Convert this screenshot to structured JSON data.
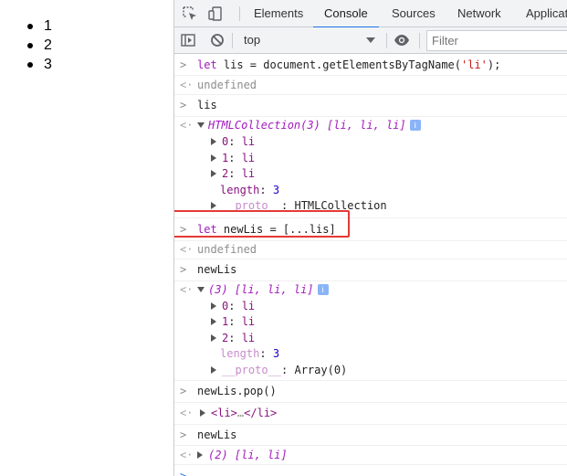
{
  "page": {
    "list_items": [
      "1",
      "2",
      "3"
    ]
  },
  "devtools": {
    "tabs": [
      "Elements",
      "Console",
      "Sources",
      "Network",
      "Applicat"
    ],
    "active_tab": "Console",
    "toolbar": {
      "context": "top",
      "filter_placeholder": "Filter"
    },
    "icons": [
      "inspect-icon",
      "device-toggle-icon",
      "sidebar-toggle-icon",
      "clear-console-icon",
      "eye-icon"
    ],
    "colors": {
      "active_tab_underline": "#1a73e8",
      "highlight_box": "#e53935"
    }
  },
  "console": {
    "m1_input": [
      "let",
      " lis = document.getElementsByTagName(",
      "'li'",
      ");"
    ],
    "m1_result": "undefined",
    "m2_input": "lis",
    "m2_summary": [
      "HTMLCollection(3) [",
      "li, li, li",
      "]"
    ],
    "m2_info": "i",
    "m2_children": [
      {
        "key": "0",
        "val": "li"
      },
      {
        "key": "1",
        "val": "li"
      },
      {
        "key": "2",
        "val": "li"
      }
    ],
    "m2_length_key": "length",
    "m2_length_val": "3",
    "m2_proto_key": "__proto__",
    "m2_proto_val": ": HTMLCollection",
    "m3_input": [
      "let",
      " newLis = [...lis]"
    ],
    "m3_result": "undefined",
    "m4_input": "newLis",
    "m4_summary": [
      "(3) [",
      "li, li, li",
      "]"
    ],
    "m4_info": "i",
    "m4_children": [
      {
        "key": "0",
        "val": "li"
      },
      {
        "key": "1",
        "val": "li"
      },
      {
        "key": "2",
        "val": "li"
      }
    ],
    "m4_length_key": "length",
    "m4_length_val": "3",
    "m4_proto_key": "__proto__",
    "m4_proto_val": ": Array(0)",
    "m5_input": "newLis.pop()",
    "m5_result": [
      "<li>",
      "…",
      "</li>"
    ],
    "m6_input": "newLis",
    "m6_summary": [
      "(2) [",
      "li, li",
      "]"
    ]
  }
}
